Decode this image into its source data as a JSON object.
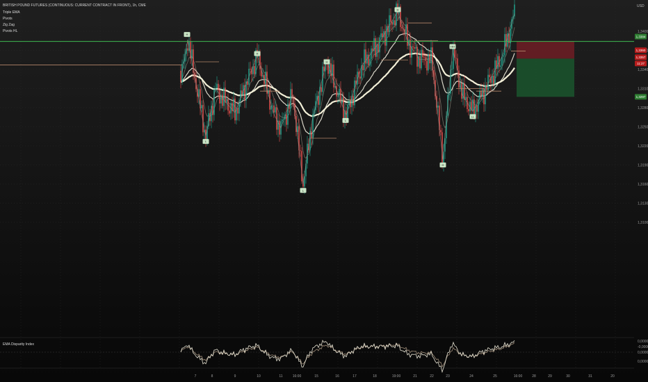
{
  "header": {
    "title": "BRITISH POUND FUTURES (CONTINUOUS: CURRENT CONTRACT IN FRONT), 1h, CME",
    "currency": "USD",
    "indicators": [
      "Triple EMA",
      "Pivots",
      "Zig Zag",
      "Pivots HL"
    ]
  },
  "oscillator": {
    "title": "EMA Disparity Index"
  },
  "colors": {
    "bull": "#22ab94",
    "bear": "#ef5350",
    "ema_fast": "#6e6a60",
    "ema_mid": "#d8d6c8",
    "ema_slow": "#f3f0d8",
    "level_line": "#3fb950",
    "pivot_line": "#b5876a",
    "zigzag": "#8a8f86",
    "pivot_label": "#c9e4c5",
    "stop_zone": "#7a1d26",
    "target_zone": "#1b5e30"
  },
  "chart_data": [
    {
      "type": "candlestick",
      "y_axis_ticks": [
        "1,3400",
        "1,3370",
        "1,3340",
        "1,3310",
        "1,3280",
        "1,3250",
        "1,3220",
        "1,3190",
        "1,3160",
        "1,3130",
        "1,3100"
      ],
      "x_axis_ticks": [
        "7",
        "8",
        "9",
        "10",
        "11",
        "16:00",
        "15",
        "16",
        "17",
        "18",
        "19:00",
        "21",
        "22",
        "23",
        "24",
        "25",
        "16:00",
        "28",
        "29",
        "30",
        "31",
        "20"
      ],
      "price_labels": [
        {
          "text": "1,3384",
          "color": "#2e7d32"
        },
        {
          "text": "1,3360",
          "color": "#b71c1c"
        },
        {
          "text": "1,3357",
          "color": "#b71c1c"
        },
        {
          "text": "11:27",
          "color": "#b71c1c"
        },
        {
          "text": "1,3297",
          "color": "#2e7d32"
        }
      ],
      "level": 1.3384,
      "pivot_labels": [
        "H",
        "H",
        "L",
        "H",
        "L",
        "H",
        "L",
        "HH",
        "H",
        "LL",
        "L"
      ],
      "position": {
        "entry": 1.3357,
        "stop": 1.3384,
        "target": 1.3297
      }
    },
    {
      "type": "line",
      "title": "EMA Disparity Index",
      "y_axis_ticks": [
        "0,0000",
        "-0,0000",
        "0,0000",
        "0,0000"
      ]
    }
  ]
}
